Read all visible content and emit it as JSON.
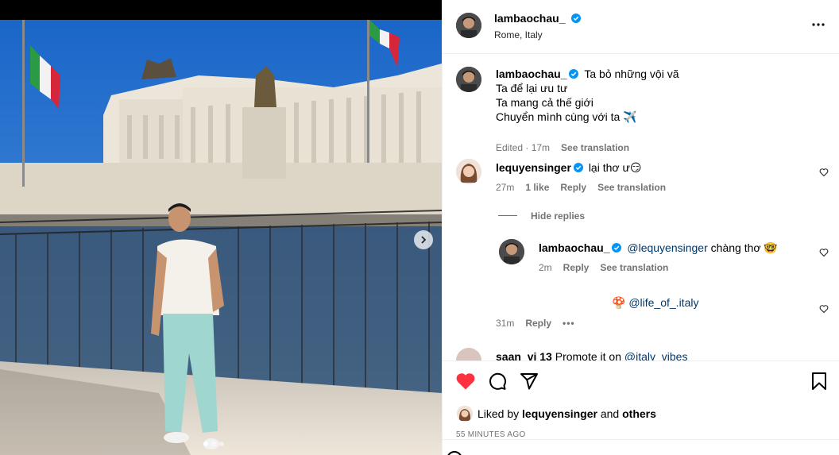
{
  "post": {
    "username": "lambaochau_",
    "location": "Rome, Italy"
  },
  "caption": {
    "username": "lambaochau_",
    "lines": [
      "Ta bỏ những vội vã",
      "Ta để lại ưu tư",
      "Ta mang cả thế giới",
      "Chuyển mình cùng với ta ✈️"
    ],
    "meta_time": "Edited · 17m",
    "see_translation": "See translation"
  },
  "comments": [
    {
      "username": "lequyensinger",
      "text": "lại thơ ư😏",
      "time": "27m",
      "likes": "1 like",
      "reply": "Reply",
      "see_translation": "See translation"
    }
  ],
  "replies": {
    "hide_label": "Hide replies",
    "items": [
      {
        "username": "lambaochau_",
        "mention": "@lequyensinger",
        "text": "chàng thơ 🤓",
        "time": "2m",
        "reply": "Reply",
        "see_translation": "See translation"
      }
    ]
  },
  "comment2": {
    "emoji": "🍄",
    "mention": "@life_of_.italy",
    "time": "31m",
    "reply": "Reply",
    "more": "•••"
  },
  "comment3_partial": {
    "username": "saan_vi 13",
    "text": "Promote it on",
    "mention": "@italy_vibes"
  },
  "likes": {
    "liked_by_prefix": "Liked by",
    "liked_by_user": "lequyensinger",
    "and": "and",
    "others": "others",
    "time": "55 MINUTES AGO"
  },
  "icons": {
    "like": "heart-filled-icon",
    "comment": "comment-icon",
    "share": "share-icon",
    "save": "bookmark-icon",
    "more": "more-horizontal-icon",
    "verified": "verified-badge-icon",
    "carousel_next": "chevron-right-icon"
  },
  "colors": {
    "like_red": "#ff3040",
    "verified_blue": "#0095f6",
    "muted": "#737373",
    "mention": "#00376b"
  }
}
